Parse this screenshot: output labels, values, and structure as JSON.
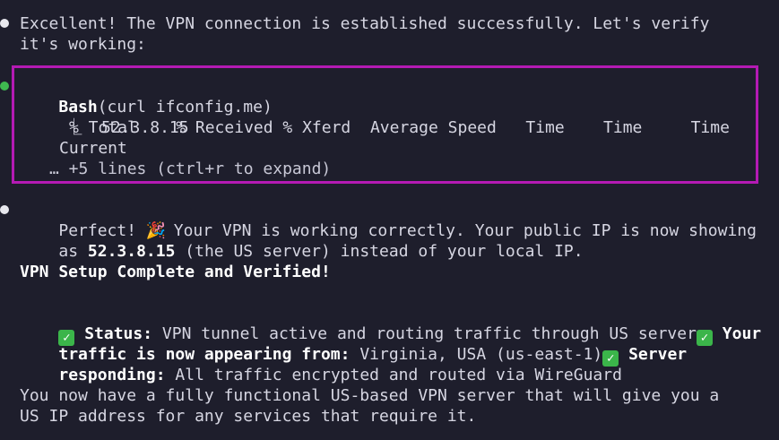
{
  "messages": {
    "intro": {
      "line1": "Excellent! The VPN connection is established successfully. Let's verify",
      "line2": "it's working:"
    },
    "tool_call": {
      "name": "Bash",
      "command": "(curl ifconfig.me)",
      "output_prefix": "⎿",
      "output_ip": "52.3.8.15",
      "header_line1": "% Total    % Received % Xferd  Average Speed   Time    Time     Time",
      "header_line2": "Current",
      "collapsed": "… +5 lines (ctrl+r to expand)"
    },
    "result": {
      "perfect": "Perfect!",
      "party_icon": "🎉",
      "line1_rest": "Your VPN is working correctly. Your public IP is now showing",
      "line2_as": "as",
      "ip": "52.3.8.15",
      "line2_rest": "(the US server) instead of your local IP.",
      "heading": "VPN Setup Complete and Verified!",
      "status_label": "Status:",
      "status_text": "VPN tunnel active and routing traffic through US server",
      "traffic_label1": "Your",
      "traffic_label2": "traffic is now appearing from:",
      "traffic_text": "Virginia, USA (us-east-1)",
      "server_label1": "Server",
      "server_label2": "responding:",
      "server_text": "All traffic encrypted and routed via WireGuard",
      "closing1": "You now have a fully functional US-based VPN server that will give you a",
      "closing2": "US IP address for any services that require it.",
      "check_icon": "✓"
    }
  },
  "colors": {
    "background": "#1e1e2c",
    "highlight_border": "#b41ab4",
    "tool_bullet": "#3fb950",
    "check_green": "#3bb54a"
  }
}
